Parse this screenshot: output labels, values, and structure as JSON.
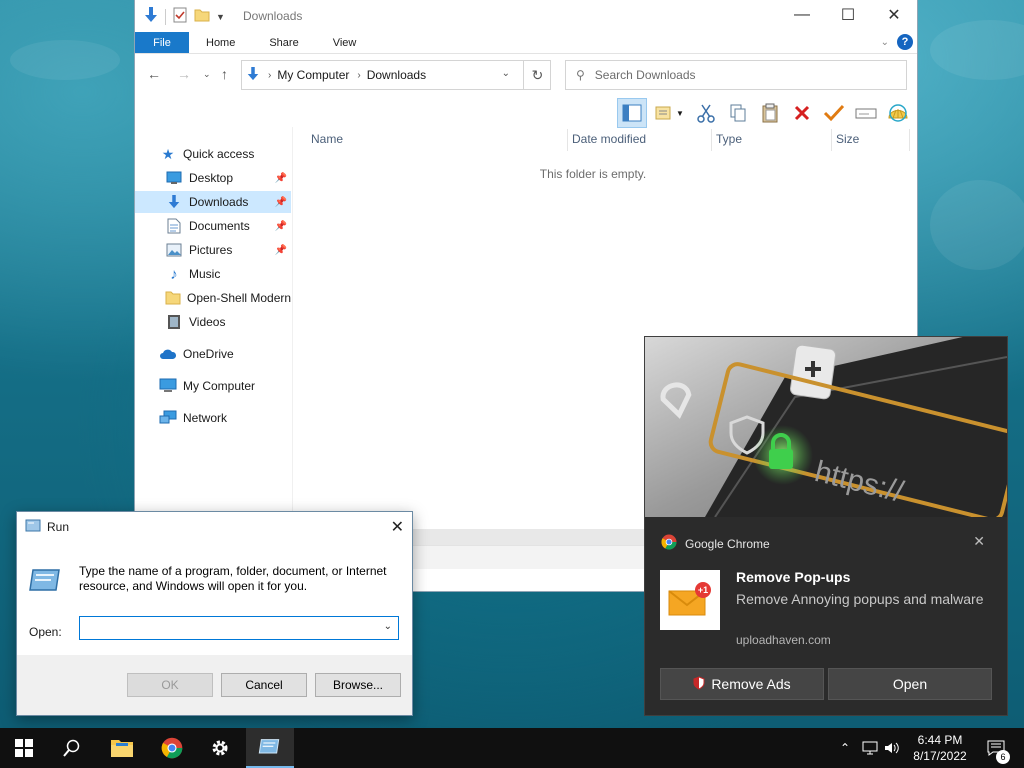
{
  "explorer": {
    "title": "Downloads",
    "tabs": [
      "File",
      "Home",
      "Share",
      "View"
    ],
    "address": {
      "root": "My Computer",
      "current": "Downloads"
    },
    "search_placeholder": "Search Downloads",
    "columns": [
      "Name",
      "Date modified",
      "Type",
      "Size"
    ],
    "empty_message": "This folder is empty.",
    "nav": {
      "quick_access": "Quick access",
      "desktop": "Desktop",
      "downloads": "Downloads",
      "documents": "Documents",
      "pictures": "Pictures",
      "music": "Music",
      "open_shell": "Open-Shell Modern",
      "videos": "Videos",
      "onedrive": "OneDrive",
      "my_computer": "My Computer",
      "network": "Network"
    }
  },
  "run": {
    "title": "Run",
    "description": "Type the name of a program, folder, document, or Internet resource, and Windows will open it for you.",
    "open_label": "Open:",
    "open_value": "",
    "ok": "OK",
    "cancel": "Cancel",
    "browse": "Browse..."
  },
  "notification": {
    "source": "Google Chrome",
    "badge": "+1",
    "title": "Remove Pop-ups",
    "message": "Remove Annoying popups and malware",
    "attribution": "uploadhaven.com",
    "hero_text": "https://",
    "btn_remove_ads": "Remove Ads",
    "btn_open": "Open"
  },
  "taskbar": {
    "time": "6:44 PM",
    "date": "8/17/2022",
    "notification_count": "6"
  },
  "colors": {
    "accent": "#1979ca",
    "selection": "#cce8ff",
    "toast_bg": "#2b2b2b",
    "taskbar_bg": "#101010"
  }
}
